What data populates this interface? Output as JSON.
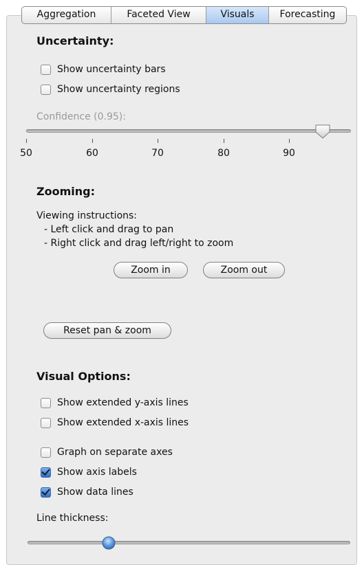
{
  "tabs": [
    {
      "label": "Aggregation",
      "selected": false
    },
    {
      "label": "Faceted View",
      "selected": false
    },
    {
      "label": "Visuals",
      "selected": true
    },
    {
      "label": "Forecasting",
      "selected": false
    }
  ],
  "uncertainty": {
    "heading": "Uncertainty:",
    "show_bars": {
      "label": "Show uncertainty bars",
      "checked": false
    },
    "show_regions": {
      "label": "Show uncertainty regions",
      "checked": false
    },
    "confidence_label": "Confidence (0.95):",
    "confidence_value": 0.95,
    "ticks": [
      "50",
      "60",
      "70",
      "80",
      "90"
    ]
  },
  "zooming": {
    "heading": "Zooming:",
    "instructions_title": "Viewing instructions:",
    "instruction_1": "- Left click and drag to pan",
    "instruction_2": "- Right click and drag left/right to zoom",
    "zoom_in_label": "Zoom in",
    "zoom_out_label": "Zoom out",
    "reset_label": "Reset pan & zoom"
  },
  "visual_options": {
    "heading": "Visual Options:",
    "ext_y": {
      "label": "Show extended y-axis lines",
      "checked": false
    },
    "ext_x": {
      "label": "Show extended x-axis lines",
      "checked": false
    },
    "separate_axes": {
      "label": "Graph on separate axes",
      "checked": false
    },
    "axis_labels": {
      "label": "Show axis labels",
      "checked": true
    },
    "data_lines": {
      "label": "Show data lines",
      "checked": true
    },
    "line_thickness_label": "Line thickness:"
  },
  "colors": {
    "selected_tab": "#a9c9f0",
    "checkbox_checked": "#2f6fc4",
    "slider_knob_blue": "#3d7fd6"
  }
}
